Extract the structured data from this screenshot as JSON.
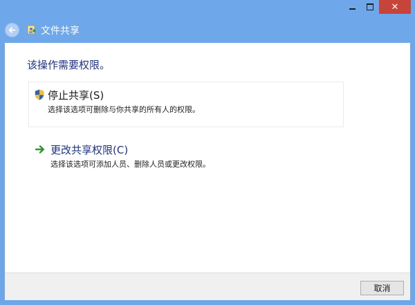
{
  "window": {
    "title": "文件共享",
    "close_glyph": "✕"
  },
  "content": {
    "heading": "该操作需要权限。",
    "options": [
      {
        "title": "停止共享(S)",
        "description": "选择该选项可删除与你共享的所有人的权限。",
        "icon": "shield-icon"
      },
      {
        "title": "更改共享权限(C)",
        "description": "选择该选项可添加人员、删除人员或更改权限。",
        "icon": "green-arrow-icon"
      }
    ]
  },
  "footer": {
    "cancel_label": "取消"
  },
  "colors": {
    "title_bar": "#6fa7eb",
    "close_button": "#c7443b",
    "heading_text": "#1e3287",
    "arrow_green": "#2b9a2b"
  }
}
